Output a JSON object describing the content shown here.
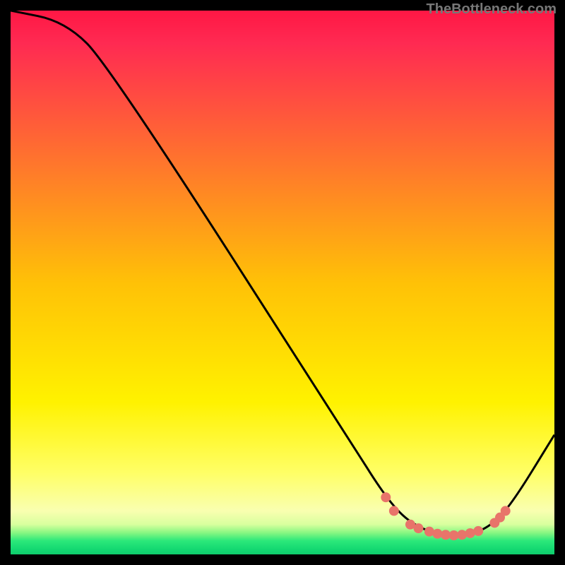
{
  "watermark": "TheBottleneck.com",
  "chart_data": {
    "type": "line",
    "title": "",
    "xlabel": "",
    "ylabel": "",
    "xlim": [
      0,
      100
    ],
    "ylim": [
      0,
      100
    ],
    "curve": [
      {
        "x": 0,
        "y": 100
      },
      {
        "x": 10,
        "y": 98
      },
      {
        "x": 18,
        "y": 90
      },
      {
        "x": 63,
        "y": 20
      },
      {
        "x": 68,
        "y": 12
      },
      {
        "x": 72,
        "y": 7
      },
      {
        "x": 76,
        "y": 4.5
      },
      {
        "x": 80,
        "y": 3.5
      },
      {
        "x": 84,
        "y": 3.5
      },
      {
        "x": 88,
        "y": 5
      },
      {
        "x": 92,
        "y": 9
      },
      {
        "x": 100,
        "y": 22
      }
    ],
    "dots": [
      {
        "x": 69,
        "y": 10.5
      },
      {
        "x": 70.5,
        "y": 8
      },
      {
        "x": 73.5,
        "y": 5.5
      },
      {
        "x": 75,
        "y": 4.8
      },
      {
        "x": 77,
        "y": 4.2
      },
      {
        "x": 78.5,
        "y": 3.8
      },
      {
        "x": 80,
        "y": 3.6
      },
      {
        "x": 81.5,
        "y": 3.5
      },
      {
        "x": 83,
        "y": 3.6
      },
      {
        "x": 84.5,
        "y": 3.9
      },
      {
        "x": 86,
        "y": 4.3
      },
      {
        "x": 89,
        "y": 5.8
      },
      {
        "x": 90,
        "y": 6.8
      },
      {
        "x": 91,
        "y": 8
      }
    ],
    "gradient_stops": [
      {
        "offset": 0,
        "color": "#ff1744"
      },
      {
        "offset": 0.06,
        "color": "#ff2a52"
      },
      {
        "offset": 0.5,
        "color": "#ffc107"
      },
      {
        "offset": 0.72,
        "color": "#fff200"
      },
      {
        "offset": 0.85,
        "color": "#ffff66"
      },
      {
        "offset": 0.92,
        "color": "#f9ffb0"
      },
      {
        "offset": 0.945,
        "color": "#d8ff9e"
      },
      {
        "offset": 0.96,
        "color": "#88f782"
      },
      {
        "offset": 0.975,
        "color": "#2be87a"
      },
      {
        "offset": 0.99,
        "color": "#14d972"
      },
      {
        "offset": 1,
        "color": "#0fcd6c"
      }
    ]
  }
}
